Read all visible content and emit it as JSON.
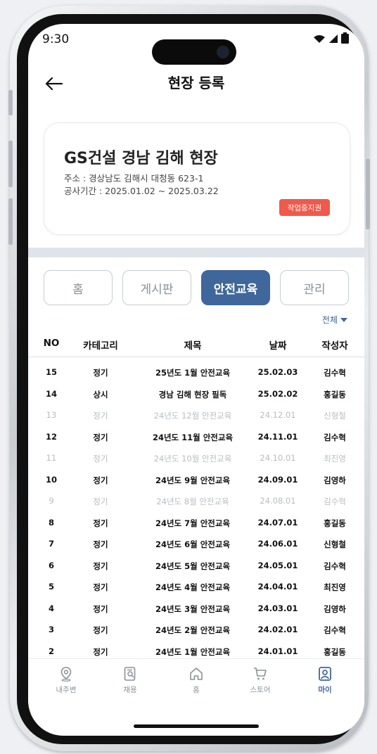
{
  "status": {
    "time": "9:30"
  },
  "header": {
    "title": "현장 등록"
  },
  "site": {
    "name": "GS건설 경남 김해 현장",
    "address": "주소 : 경상남도 김해시 대청동 623-1",
    "period": "공사기간 : 2025.01.02 ~ 2025.03.22",
    "stop_button": "작업중지권"
  },
  "tabs": [
    {
      "label": "홈",
      "active": false
    },
    {
      "label": "게시판",
      "active": false
    },
    {
      "label": "안전교육",
      "active": true
    },
    {
      "label": "관리",
      "active": false
    }
  ],
  "filter": {
    "label": "전체"
  },
  "table": {
    "headers": {
      "no": "NO",
      "category": "카테고리",
      "title": "제목",
      "date": "날짜",
      "author": "작성자"
    },
    "rows": [
      {
        "no": "15",
        "category": "정기",
        "title": "25년도 1월 안전교육",
        "date": "25.02.03",
        "author": "김수혁",
        "dim": false
      },
      {
        "no": "14",
        "category": "상시",
        "title": "경남 김해 현장 필독",
        "date": "25.02.02",
        "author": "홍길동",
        "dim": false
      },
      {
        "no": "13",
        "category": "정기",
        "title": "24년도 12월 안전교육",
        "date": "24.12.01",
        "author": "신형철",
        "dim": true
      },
      {
        "no": "12",
        "category": "정기",
        "title": "24년도 11월 안전교육",
        "date": "24.11.01",
        "author": "김수혁",
        "dim": false
      },
      {
        "no": "11",
        "category": "정기",
        "title": "24년도 10월 안전교육",
        "date": "24.10.01",
        "author": "최진영",
        "dim": true
      },
      {
        "no": "10",
        "category": "정기",
        "title": "24년도 9월 안전교육",
        "date": "24.09.01",
        "author": "김영하",
        "dim": false
      },
      {
        "no": "9",
        "category": "정기",
        "title": "24년도 8월 안전교육",
        "date": "24.08.01",
        "author": "김수혁",
        "dim": true
      },
      {
        "no": "8",
        "category": "정기",
        "title": "24년도 7월 안전교육",
        "date": "24.07.01",
        "author": "홍길동",
        "dim": false
      },
      {
        "no": "7",
        "category": "정기",
        "title": "24년도 6월 안전교육",
        "date": "24.06.01",
        "author": "신형철",
        "dim": false
      },
      {
        "no": "6",
        "category": "정기",
        "title": "24년도 5월 안전교육",
        "date": "24.05.01",
        "author": "김수혁",
        "dim": false
      },
      {
        "no": "5",
        "category": "정기",
        "title": "24년도 4월 안전교육",
        "date": "24.04.01",
        "author": "최진영",
        "dim": false
      },
      {
        "no": "4",
        "category": "정기",
        "title": "24년도 3월 안전교육",
        "date": "24.03.01",
        "author": "김영하",
        "dim": false
      },
      {
        "no": "3",
        "category": "정기",
        "title": "24년도 2월 안전교육",
        "date": "24.02.01",
        "author": "김수혁",
        "dim": false
      },
      {
        "no": "2",
        "category": "정기",
        "title": "24년도 1월 안전교육",
        "date": "24.01.01",
        "author": "홍길동",
        "dim": false
      }
    ]
  },
  "bottom_nav": [
    {
      "label": "내주변",
      "icon": "location-pin-icon",
      "active": false
    },
    {
      "label": "채용",
      "icon": "document-search-icon",
      "active": false
    },
    {
      "label": "홈",
      "icon": "home-icon",
      "active": false
    },
    {
      "label": "스토어",
      "icon": "cart-icon",
      "active": false
    },
    {
      "label": "마이",
      "icon": "person-icon",
      "active": true
    }
  ],
  "colors": {
    "accent": "#3f679b",
    "danger": "#ef5a4c",
    "divider": "#dfe4ea"
  }
}
